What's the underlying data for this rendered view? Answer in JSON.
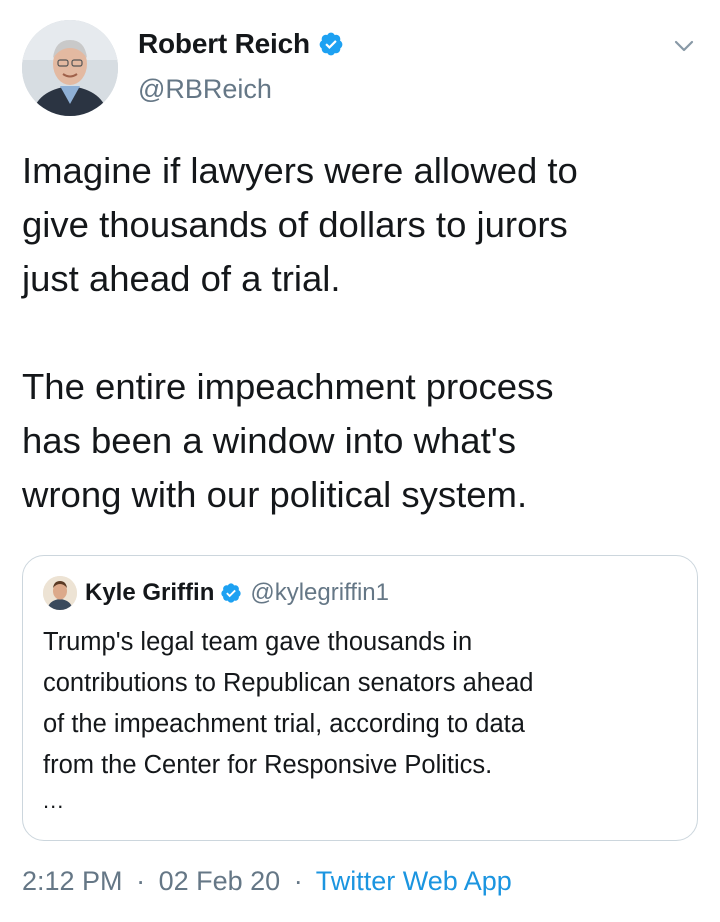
{
  "author": {
    "name": "Robert Reich",
    "handle": "@RBReich",
    "verified_icon": "verified-badge-icon"
  },
  "tweet": {
    "lines_paragraph_1": [
      "Imagine if lawyers were allowed to",
      "give thousands of dollars to jurors",
      "just ahead of a trial."
    ],
    "lines_paragraph_2": [
      "The entire impeachment process",
      "has been a window into what's",
      "wrong with our political system."
    ]
  },
  "quoted_tweet": {
    "name": "Kyle Griffin",
    "handle": "@kylegriffin1",
    "lines": [
      "Trump's legal team gave thousands in",
      "contributions to Republican senators ahead",
      "of the impeachment trial, according to data",
      "from the Center for Responsive Politics."
    ],
    "ellipsis": "..."
  },
  "meta": {
    "time": "2:12 PM",
    "separator": "·",
    "date": "02 Feb 20",
    "source": "Twitter Web App"
  },
  "colors": {
    "text": "#14171a",
    "secondary": "#657786",
    "accent": "#1b95e0",
    "border": "#ccd6dd"
  }
}
